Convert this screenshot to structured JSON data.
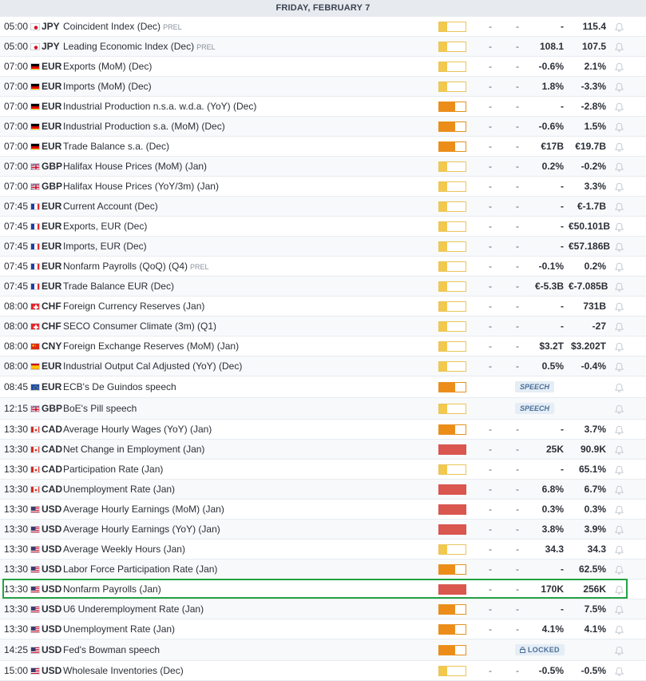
{
  "header": {
    "date": "FRIDAY, FEBRUARY 7"
  },
  "colors": {
    "low_impact": "#f2c94c",
    "medium_impact": "#ec8d1a",
    "high_impact": "#d9574e",
    "highlight_border": "#25a244"
  },
  "events": [
    {
      "time": "05:00",
      "flag": "jp",
      "currency": "JPY",
      "event": "Coincident Index (Dec)",
      "tag": "PREL",
      "impact": "low",
      "actual": "-",
      "deviation": "-",
      "consensus": "-",
      "previous": "115.4"
    },
    {
      "time": "05:00",
      "flag": "jp",
      "currency": "JPY",
      "event": "Leading Economic Index (Dec)",
      "tag": "PREL",
      "impact": "low",
      "actual": "-",
      "deviation": "-",
      "consensus": "108.1",
      "previous": "107.5"
    },
    {
      "time": "07:00",
      "flag": "de",
      "currency": "EUR",
      "event": "Exports (MoM) (Dec)",
      "tag": "",
      "impact": "low",
      "actual": "-",
      "deviation": "-",
      "consensus": "-0.6%",
      "previous": "2.1%"
    },
    {
      "time": "07:00",
      "flag": "de",
      "currency": "EUR",
      "event": "Imports (MoM) (Dec)",
      "tag": "",
      "impact": "low",
      "actual": "-",
      "deviation": "-",
      "consensus": "1.8%",
      "previous": "-3.3%"
    },
    {
      "time": "07:00",
      "flag": "de",
      "currency": "EUR",
      "event": "Industrial Production n.s.a. w.d.a. (YoY) (Dec)",
      "tag": "",
      "impact": "medium",
      "actual": "-",
      "deviation": "-",
      "consensus": "-",
      "previous": "-2.8%"
    },
    {
      "time": "07:00",
      "flag": "de",
      "currency": "EUR",
      "event": "Industrial Production s.a. (MoM) (Dec)",
      "tag": "",
      "impact": "medium",
      "actual": "-",
      "deviation": "-",
      "consensus": "-0.6%",
      "previous": "1.5%"
    },
    {
      "time": "07:00",
      "flag": "de",
      "currency": "EUR",
      "event": "Trade Balance s.a. (Dec)",
      "tag": "",
      "impact": "medium",
      "actual": "-",
      "deviation": "-",
      "consensus": "€17B",
      "previous": "€19.7B"
    },
    {
      "time": "07:00",
      "flag": "gb",
      "currency": "GBP",
      "event": "Halifax House Prices (MoM) (Jan)",
      "tag": "",
      "impact": "low",
      "actual": "-",
      "deviation": "-",
      "consensus": "0.2%",
      "previous": "-0.2%"
    },
    {
      "time": "07:00",
      "flag": "gb",
      "currency": "GBP",
      "event": "Halifax House Prices (YoY/3m) (Jan)",
      "tag": "",
      "impact": "low",
      "actual": "-",
      "deviation": "-",
      "consensus": "-",
      "previous": "3.3%"
    },
    {
      "time": "07:45",
      "flag": "fr",
      "currency": "EUR",
      "event": "Current Account (Dec)",
      "tag": "",
      "impact": "low",
      "actual": "-",
      "deviation": "-",
      "consensus": "-",
      "previous": "€-1.7B"
    },
    {
      "time": "07:45",
      "flag": "fr",
      "currency": "EUR",
      "event": "Exports, EUR (Dec)",
      "tag": "",
      "impact": "low",
      "actual": "-",
      "deviation": "-",
      "consensus": "-",
      "previous": "€50.101B"
    },
    {
      "time": "07:45",
      "flag": "fr",
      "currency": "EUR",
      "event": "Imports, EUR (Dec)",
      "tag": "",
      "impact": "low",
      "actual": "-",
      "deviation": "-",
      "consensus": "-",
      "previous": "€57.186B"
    },
    {
      "time": "07:45",
      "flag": "fr",
      "currency": "EUR",
      "event": "Nonfarm Payrolls (QoQ) (Q4)",
      "tag": "PREL",
      "impact": "low",
      "actual": "-",
      "deviation": "-",
      "consensus": "-0.1%",
      "previous": "0.2%"
    },
    {
      "time": "07:45",
      "flag": "fr",
      "currency": "EUR",
      "event": "Trade Balance EUR (Dec)",
      "tag": "",
      "impact": "low",
      "actual": "-",
      "deviation": "-",
      "consensus": "€-5.3B",
      "previous": "€-7.085B"
    },
    {
      "time": "08:00",
      "flag": "ch",
      "currency": "CHF",
      "event": "Foreign Currency Reserves (Jan)",
      "tag": "",
      "impact": "low",
      "actual": "-",
      "deviation": "-",
      "consensus": "-",
      "previous": "731B"
    },
    {
      "time": "08:00",
      "flag": "ch",
      "currency": "CHF",
      "event": "SECO Consumer Climate (3m) (Q1)",
      "tag": "",
      "impact": "low",
      "actual": "-",
      "deviation": "-",
      "consensus": "-",
      "previous": "-27"
    },
    {
      "time": "08:00",
      "flag": "cn",
      "currency": "CNY",
      "event": "Foreign Exchange Reserves (MoM) (Jan)",
      "tag": "",
      "impact": "low",
      "actual": "-",
      "deviation": "-",
      "consensus": "$3.2T",
      "previous": "$3.202T"
    },
    {
      "time": "08:00",
      "flag": "es",
      "currency": "EUR",
      "event": "Industrial Output Cal Adjusted (YoY) (Dec)",
      "tag": "",
      "impact": "low",
      "actual": "-",
      "deviation": "-",
      "consensus": "0.5%",
      "previous": "-0.4%"
    },
    {
      "time": "08:45",
      "flag": "eu",
      "currency": "EUR",
      "event": "ECB's De Guindos speech",
      "tag": "",
      "impact": "medium",
      "badge": "SPEECH"
    },
    {
      "time": "12:15",
      "flag": "gb",
      "currency": "GBP",
      "event": "BoE's Pill speech",
      "tag": "",
      "impact": "low",
      "badge": "SPEECH"
    },
    {
      "time": "13:30",
      "flag": "ca",
      "currency": "CAD",
      "event": "Average Hourly Wages (YoY) (Jan)",
      "tag": "",
      "impact": "medium",
      "actual": "-",
      "deviation": "-",
      "consensus": "-",
      "previous": "3.7%"
    },
    {
      "time": "13:30",
      "flag": "ca",
      "currency": "CAD",
      "event": "Net Change in Employment (Jan)",
      "tag": "",
      "impact": "high",
      "actual": "-",
      "deviation": "-",
      "consensus": "25K",
      "previous": "90.9K"
    },
    {
      "time": "13:30",
      "flag": "ca",
      "currency": "CAD",
      "event": "Participation Rate (Jan)",
      "tag": "",
      "impact": "low",
      "actual": "-",
      "deviation": "-",
      "consensus": "-",
      "previous": "65.1%"
    },
    {
      "time": "13:30",
      "flag": "ca",
      "currency": "CAD",
      "event": "Unemployment Rate (Jan)",
      "tag": "",
      "impact": "high",
      "actual": "-",
      "deviation": "-",
      "consensus": "6.8%",
      "previous": "6.7%"
    },
    {
      "time": "13:30",
      "flag": "us",
      "currency": "USD",
      "event": "Average Hourly Earnings (MoM) (Jan)",
      "tag": "",
      "impact": "high",
      "actual": "-",
      "deviation": "-",
      "consensus": "0.3%",
      "previous": "0.3%"
    },
    {
      "time": "13:30",
      "flag": "us",
      "currency": "USD",
      "event": "Average Hourly Earnings (YoY) (Jan)",
      "tag": "",
      "impact": "high",
      "actual": "-",
      "deviation": "-",
      "consensus": "3.8%",
      "previous": "3.9%"
    },
    {
      "time": "13:30",
      "flag": "us",
      "currency": "USD",
      "event": "Average Weekly Hours (Jan)",
      "tag": "",
      "impact": "low",
      "actual": "-",
      "deviation": "-",
      "consensus": "34.3",
      "previous": "34.3"
    },
    {
      "time": "13:30",
      "flag": "us",
      "currency": "USD",
      "event": "Labor Force Participation Rate (Jan)",
      "tag": "",
      "impact": "medium",
      "actual": "-",
      "deviation": "-",
      "consensus": "-",
      "previous": "62.5%"
    },
    {
      "time": "13:30",
      "flag": "us",
      "currency": "USD",
      "event": "Nonfarm Payrolls (Jan)",
      "tag": "",
      "impact": "high",
      "actual": "-",
      "deviation": "-",
      "consensus": "170K",
      "previous": "256K",
      "highlighted": true
    },
    {
      "time": "13:30",
      "flag": "us",
      "currency": "USD",
      "event": "U6 Underemployment Rate (Jan)",
      "tag": "",
      "impact": "medium",
      "actual": "-",
      "deviation": "-",
      "consensus": "-",
      "previous": "7.5%"
    },
    {
      "time": "13:30",
      "flag": "us",
      "currency": "USD",
      "event": "Unemployment Rate (Jan)",
      "tag": "",
      "impact": "medium",
      "actual": "-",
      "deviation": "-",
      "consensus": "4.1%",
      "previous": "4.1%"
    },
    {
      "time": "14:25",
      "flag": "us",
      "currency": "USD",
      "event": "Fed's Bowman speech",
      "tag": "",
      "impact": "medium",
      "badge": "LOCKED"
    },
    {
      "time": "15:00",
      "flag": "us",
      "currency": "USD",
      "event": "Wholesale Inventories (Dec)",
      "tag": "",
      "impact": "low",
      "actual": "-",
      "deviation": "-",
      "consensus": "-0.5%",
      "previous": "-0.5%"
    }
  ]
}
